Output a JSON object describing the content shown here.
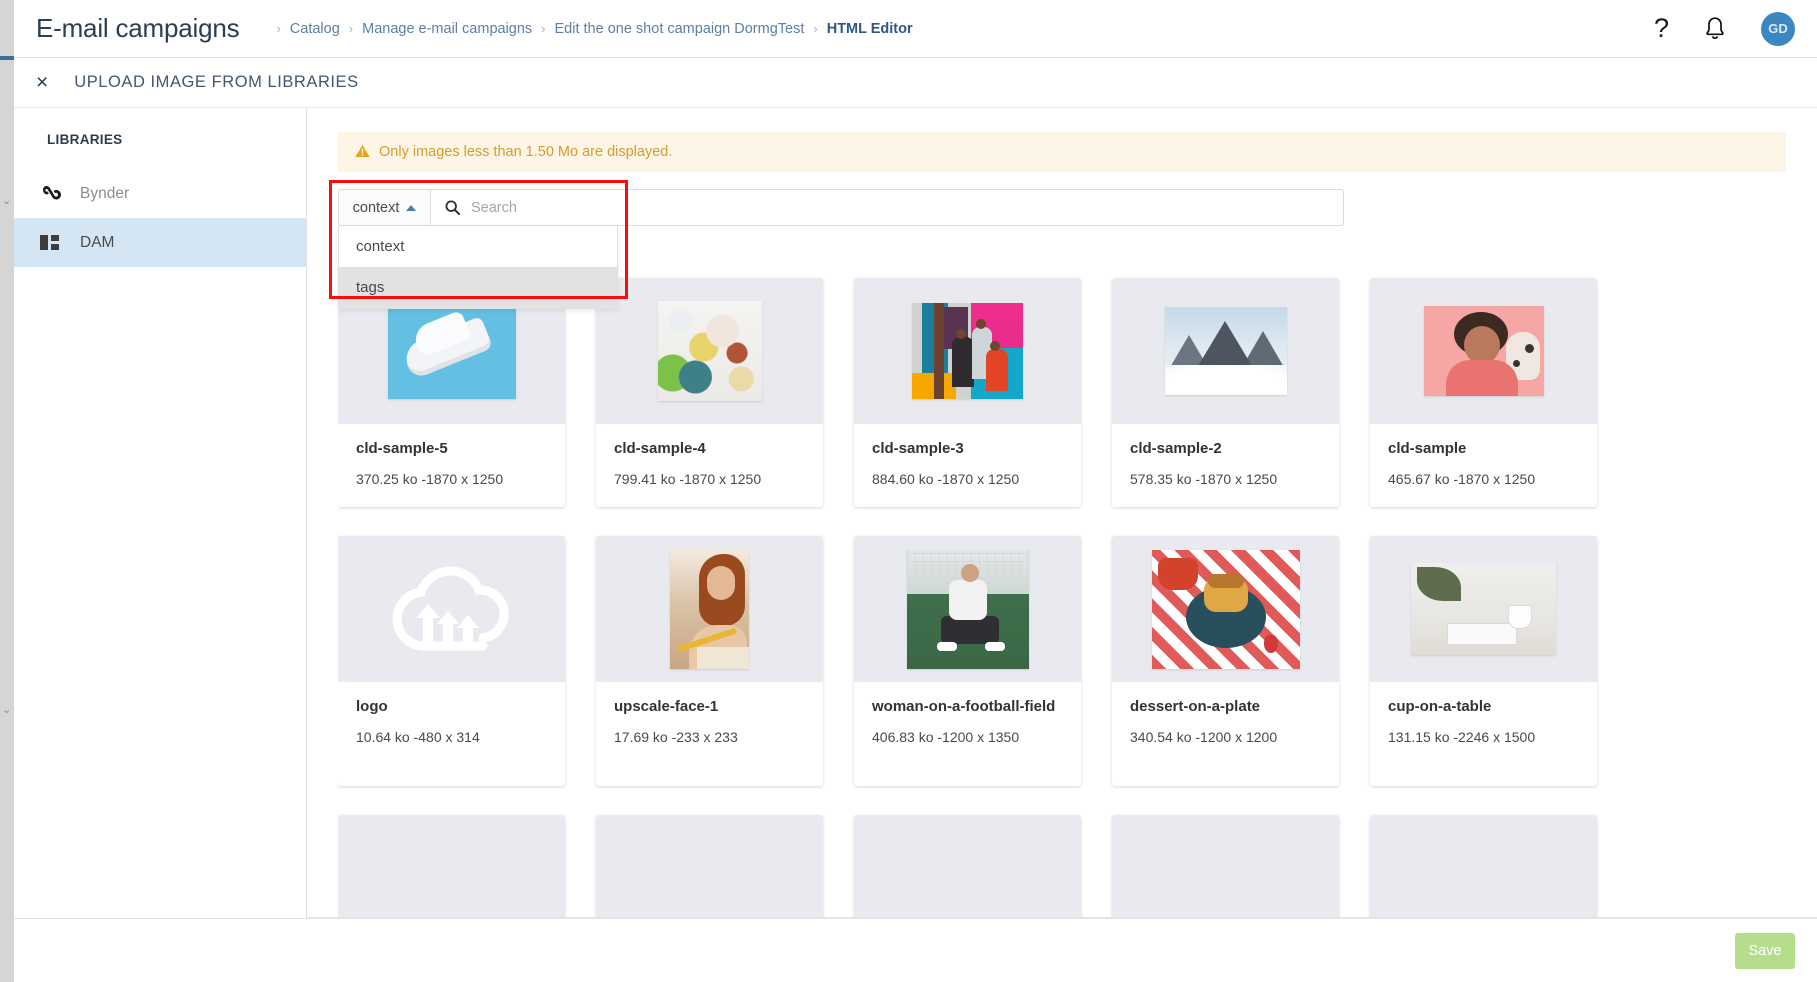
{
  "header": {
    "page_title": "E-mail campaigns",
    "breadcrumbs": [
      {
        "label": "Catalog",
        "active": false
      },
      {
        "label": "Manage e-mail campaigns",
        "active": false
      },
      {
        "label": "Edit the one shot campaign DormgTest",
        "active": false
      },
      {
        "label": "HTML Editor",
        "active": true
      }
    ],
    "separator": "›",
    "help_icon": "question-mark-icon",
    "bell_icon": "notification-bell-icon",
    "avatar_initials": "GD",
    "avatar_color": "#3b87c4"
  },
  "modal": {
    "close_label": "×",
    "title": "UPLOAD IMAGE FROM LIBRARIES"
  },
  "sidebar": {
    "heading": "LIBRARIES",
    "items": [
      {
        "label": "Bynder",
        "icon": "bynder-icon",
        "active": false
      },
      {
        "label": "DAM",
        "icon": "grid-icon",
        "active": true
      }
    ],
    "active_bg": "#d4e5f3"
  },
  "notice": {
    "icon": "warning-triangle-icon",
    "text": "Only images less than 1.50 Mo are displayed.",
    "bg": "#fdf6e7",
    "color": "#d79b2b"
  },
  "filter": {
    "selected": "context",
    "caret_icon": "caret-up-icon",
    "search_icon": "search-icon",
    "search_value": "",
    "search_placeholder": "Search",
    "dropdown_open": true,
    "options": [
      {
        "label": "context",
        "highlighted": false
      },
      {
        "label": "tags",
        "highlighted": true
      }
    ],
    "highlight_box_color": "#fb0d0d"
  },
  "gallery": {
    "items": [
      {
        "name": "cld-sample-5",
        "meta": "370.25 ko -1870 x 1250",
        "thumb": "white-sneaker-on-blue"
      },
      {
        "name": "cld-sample-4",
        "meta": "799.41 ko -1870 x 1250",
        "thumb": "breakfast-flatlay"
      },
      {
        "name": "cld-sample-3",
        "meta": "884.60 ko -1870 x 1250",
        "thumb": "basketball-players"
      },
      {
        "name": "cld-sample-2",
        "meta": "578.35 ko -1870 x 1250",
        "thumb": "snowy-mountain"
      },
      {
        "name": "cld-sample",
        "meta": "465.67 ko -1870 x 1250",
        "thumb": "laughing-woman-with-dog"
      },
      {
        "name": "logo",
        "meta": "10.64 ko -480 x 314",
        "thumb": "cloud-upload-logo"
      },
      {
        "name": "upscale-face-1",
        "meta": "17.69 ko -233 x 233",
        "thumb": "red-haired-woman"
      },
      {
        "name": "woman-on-a-football-field",
        "meta": "406.83 ko -1200 x 1350",
        "thumb": "woman-football-field"
      },
      {
        "name": "dessert-on-a-plate",
        "meta": "340.54 ko -1200 x 1200",
        "thumb": "pancake-dessert"
      },
      {
        "name": "cup-on-a-table",
        "meta": "131.15 ko -2246 x 1500",
        "thumb": "cup-on-table"
      }
    ]
  },
  "footer": {
    "save_label": "Save",
    "save_color": "#b6dd8c"
  }
}
